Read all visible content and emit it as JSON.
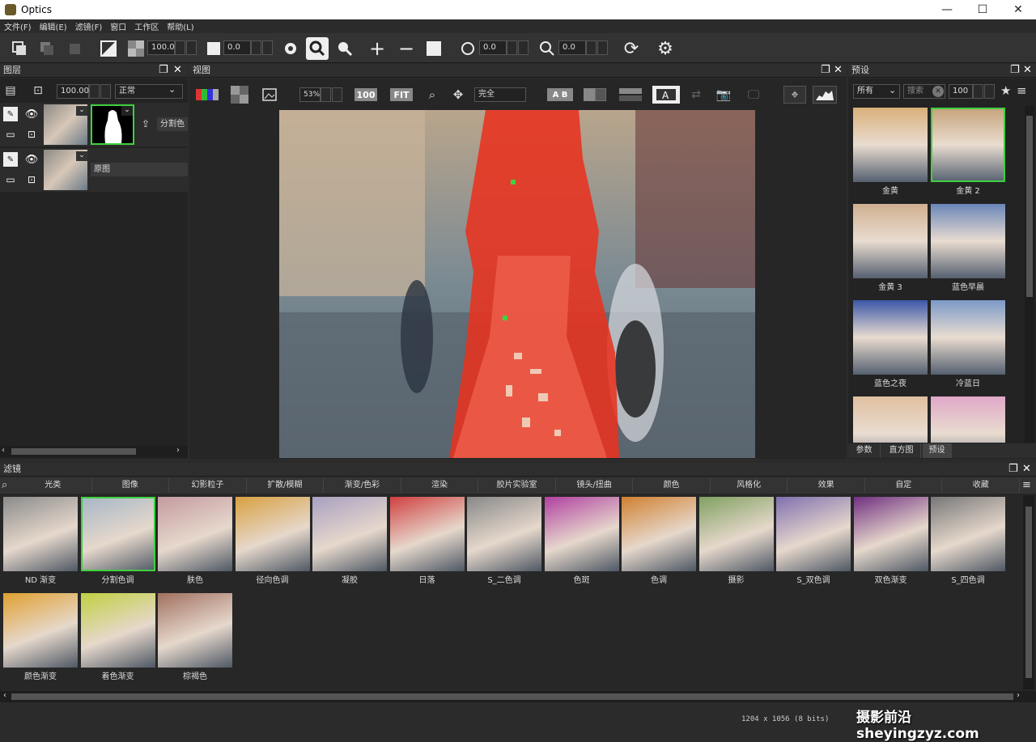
{
  "window": {
    "title": "Optics",
    "minimize": "—",
    "maximize": "☐",
    "close": "✕"
  },
  "menu": [
    "文件(F)",
    "编辑(E)",
    "滤镜(F)",
    "窗口",
    "工作区",
    "帮助(L)"
  ],
  "toolbar": {
    "opacity": "100.0",
    "brightness": "0.0",
    "ellipse": "0.0",
    "zoom": "0.0"
  },
  "layers": {
    "title": "图层",
    "opacity": "100.00",
    "blend": "正常",
    "rows": [
      {
        "label": "分割色"
      },
      {
        "label": "原图"
      }
    ]
  },
  "view": {
    "title": "视图",
    "zoom": "53%",
    "btn100": "100",
    "fit": "FIT",
    "mode": "完全",
    "ab": "A B"
  },
  "presets": {
    "title": "预设",
    "filter": "所有",
    "search_placeholder": "搜索",
    "size": "100",
    "items": [
      "金黄",
      "金黄 2",
      "金黄 3",
      "蓝色早晨",
      "蓝色之夜",
      "冷蓝日",
      "",
      ""
    ],
    "tabs": [
      "参数",
      "直方图",
      "预设"
    ],
    "selected_index": 1
  },
  "filters": {
    "title": "滤镜",
    "categories": [
      "光类",
      "图像",
      "幻影粒子",
      "扩散/模糊",
      "渐变/色彩",
      "渲染",
      "胶片实验室",
      "镜头/扭曲",
      "颜色",
      "风格化",
      "效果",
      "自定",
      "收藏"
    ],
    "items": [
      "ND 渐变",
      "分割色调",
      "肤色",
      "径向色调",
      "凝胶",
      "日落",
      "S_二色调",
      "色斑",
      "色调",
      "摄影",
      "S_双色调",
      "双色渐变",
      "S_四色调",
      "颜色渐变",
      "着色渐变",
      "棕褐色"
    ],
    "selected_index": 1
  },
  "status": {
    "info": "1204 x 1056 (8 bits)"
  },
  "watermark": "摄影前沿 sheyingzyz.com",
  "colors": {
    "accent": "#3fd13f",
    "mask": "#e8321f"
  }
}
